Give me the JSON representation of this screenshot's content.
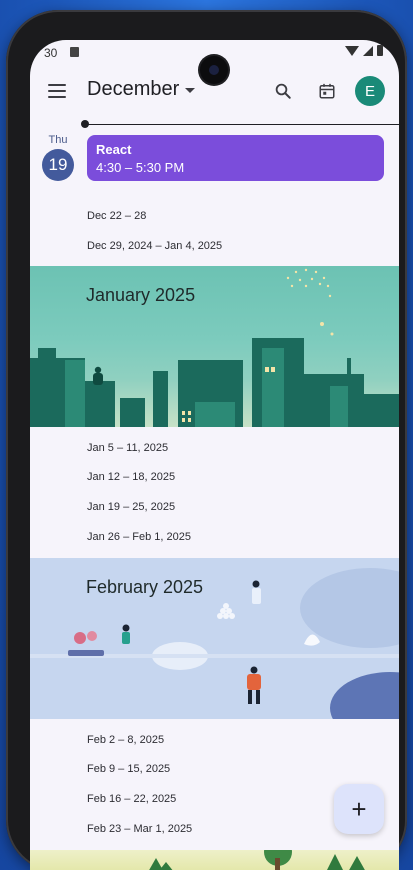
{
  "status_bar": {
    "time": "30",
    "sim_icon": "sim-card-icon",
    "wifi_icon": "wifi-icon",
    "signal_icon": "cell-signal-icon",
    "battery_icon": "battery-icon"
  },
  "app_bar": {
    "menu_icon": "menu-icon",
    "month_label": "December",
    "search_icon": "search-icon",
    "calendar_icon": "calendar-today-icon",
    "avatar_initial": "E",
    "avatar_color": "#1a8a78"
  },
  "today": {
    "day_of_week": "Thu",
    "date": "19"
  },
  "event": {
    "title": "React",
    "time": "4:30 – 5:30 PM",
    "color": "#7b4ddb"
  },
  "weeks_december": [
    "Dec 22 – 28",
    "Dec 29, 2024 – Jan 4, 2025"
  ],
  "january": {
    "title": "January 2025",
    "weeks": [
      "Jan 5 – 11, 2025",
      "Jan 12 – 18, 2025",
      "Jan 19 – 25, 2025",
      "Jan 26 – Feb 1, 2025"
    ]
  },
  "february": {
    "title": "February 2025",
    "weeks": [
      "Feb 2 – 8, 2025",
      "Feb 9 – 15, 2025",
      "Feb 16 – 22, 2025",
      "Feb 23 – Mar 1, 2025"
    ]
  },
  "fab": {
    "icon": "add-icon",
    "label": "+"
  },
  "colors": {
    "accent": "#435a9c",
    "event": "#7b4ddb",
    "background": "#f6f4fb"
  }
}
